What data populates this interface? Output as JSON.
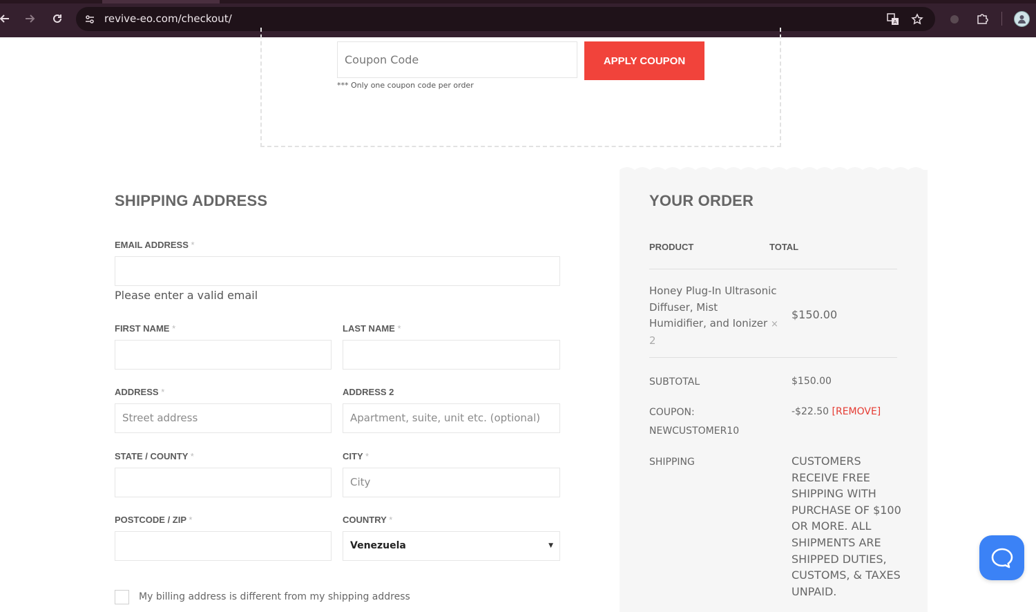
{
  "browser": {
    "url": "revive-eo.com/checkout/",
    "icons": {
      "back": "arrow-left-icon",
      "forward": "arrow-right-icon",
      "reload": "reload-icon",
      "site_info": "tune-icon",
      "translate": "translate-icon",
      "bookmark": "star-icon",
      "extension_1": "puzzle-extension-icon",
      "extensions": "puzzle-icon",
      "profile": "avatar"
    }
  },
  "coupon": {
    "placeholder": "Coupon Code",
    "apply_label": "APPLY COUPON",
    "note": "*** Only one coupon code per order",
    "button_color": "#f1433b"
  },
  "shipping": {
    "title": "SHIPPING ADDRESS",
    "email_label": "EMAIL ADDRESS",
    "email_error": "Please enter a valid email",
    "first_name_label": "FIRST NAME",
    "last_name_label": "LAST NAME",
    "address_label": "ADDRESS",
    "address_placeholder": "Street address",
    "address2_label": "ADDRESS 2",
    "address2_placeholder": "Apartment, suite, unit etc. (optional)",
    "state_label": "STATE / COUNTY",
    "city_label": "CITY",
    "city_placeholder": "City",
    "postcode_label": "POSTCODE / ZIP",
    "country_label": "COUNTRY",
    "country_value": "Venezuela",
    "required_marker": "*",
    "billing_different_label": "My billing address is different from my shipping address"
  },
  "order": {
    "title": "YOUR ORDER",
    "col_product": "PRODUCT",
    "col_total": "TOTAL",
    "item": {
      "name_line1": "Honey Plug-In Ultrasonic",
      "name_line2": "Diffuser, Mist",
      "name_line3": "Humidifier, and Ionizer",
      "times": "×",
      "qty": "2",
      "total": "$150.00"
    },
    "subtotal_label": "SUBTOTAL",
    "subtotal_value": "$150.00",
    "coupon_label": "COUPON:",
    "coupon_code": "NEWCUSTOMER10",
    "coupon_value": "-$22.50",
    "coupon_remove": "[REMOVE]",
    "shipping_label": "SHIPPING",
    "shipping_note": "CUSTOMERS RECEIVE FREE SHIPPING WITH PURCHASE OF $100 OR MORE. ALL SHIPMENTS ARE SHIPPED DUTIES, CUSTOMS, & TAXES UNPAID.",
    "accent_color": "#e53b32"
  },
  "chat": {
    "icon": "chat-bubble-icon",
    "color": "#3b82f6"
  }
}
